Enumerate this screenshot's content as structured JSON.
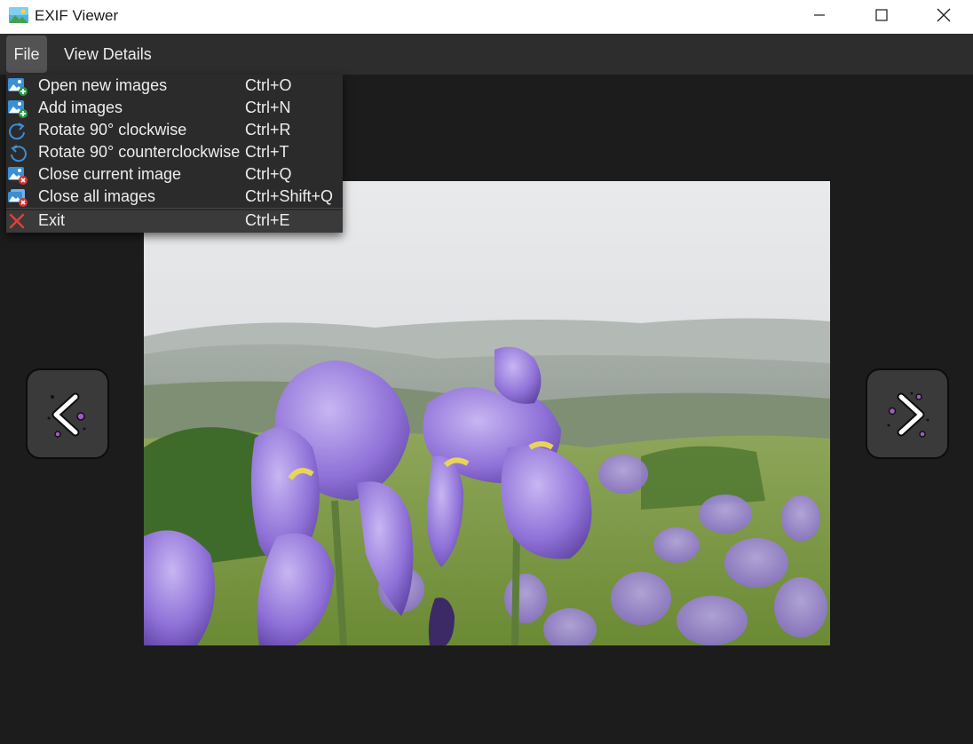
{
  "window": {
    "title": "EXIF Viewer",
    "app_icon": "picture-icon",
    "controls": [
      "minimize-icon",
      "maximize-icon",
      "close-icon"
    ]
  },
  "menubar": {
    "file_label": "File",
    "view_details_label": "View Details"
  },
  "file_menu": {
    "items": [
      {
        "label": "Open new images",
        "shortcut": "Ctrl+O",
        "icon": "image-add-icon"
      },
      {
        "label": "Add images",
        "shortcut": "Ctrl+N",
        "icon": "image-add-icon"
      },
      {
        "label": "Rotate 90° clockwise",
        "shortcut": "Ctrl+R",
        "icon": "rotate-clockwise-icon"
      },
      {
        "label": "Rotate 90° counterclockwise",
        "shortcut": "Ctrl+T",
        "icon": "rotate-counterclockwise-icon"
      },
      {
        "label": "Close current image",
        "shortcut": "Ctrl+Q",
        "icon": "image-remove-icon"
      },
      {
        "label": "Close all images",
        "shortcut": "Ctrl+Shift+Q",
        "icon": "images-remove-icon"
      },
      {
        "label": "Exit",
        "shortcut": "Ctrl+E",
        "icon": "exit-x-icon"
      }
    ]
  },
  "viewer": {
    "prev_icon": "chevron-left-icon",
    "next_icon": "chevron-right-icon"
  },
  "colors": {
    "background": "#1c1c1c",
    "menubar": "#2d2d2d",
    "menu_text": "#ececec",
    "icon_blue": "#3a8fd6",
    "exit_red": "#e0403a",
    "nav_accent": "#a05ac8"
  }
}
